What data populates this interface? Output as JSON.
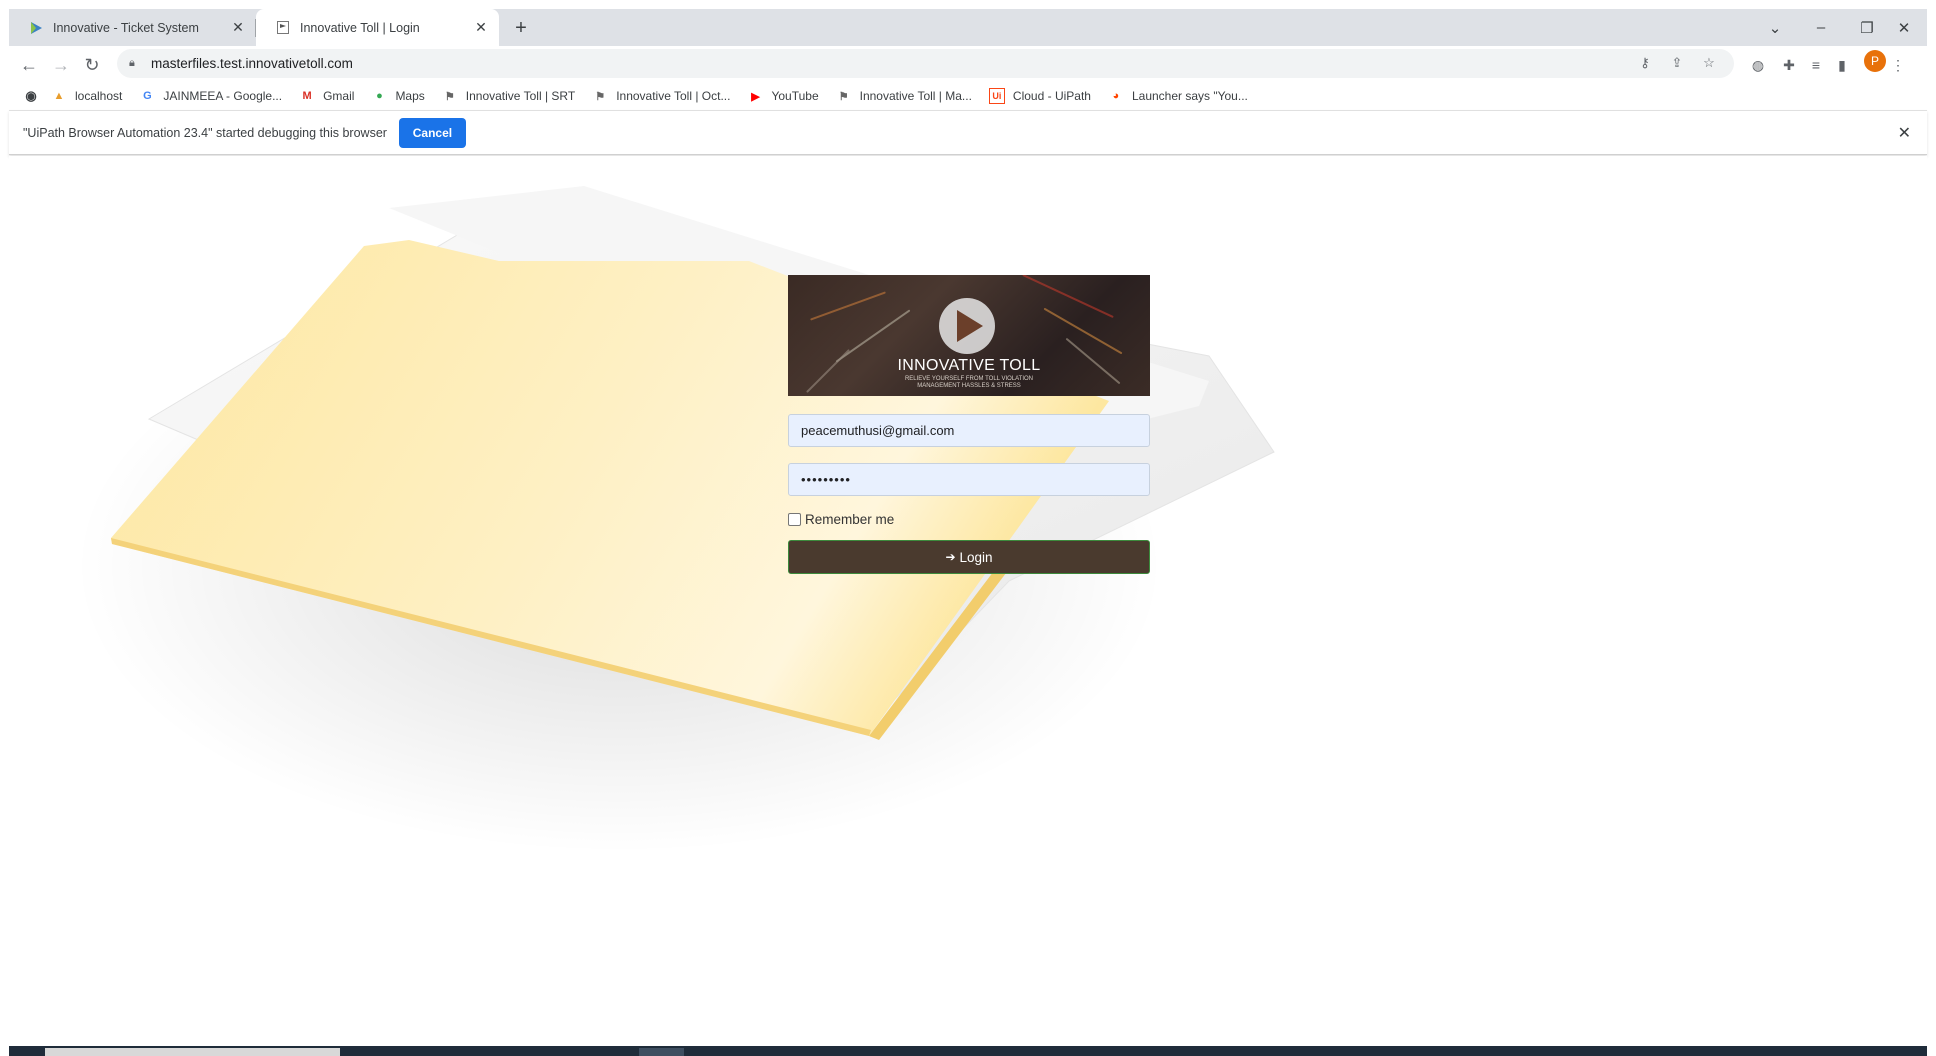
{
  "browser": {
    "tabs": [
      {
        "title": "Innovative - Ticket System",
        "icon": "play-logo-icon"
      },
      {
        "title": "Innovative Toll | Login",
        "icon": "flag-page-icon"
      }
    ],
    "address": {
      "url": "masterfiles.test.innovativetoll.com"
    },
    "bookmarks": [
      {
        "label": "localhost",
        "icon": "phpmyadmin-icon"
      },
      {
        "label": "JAINMEEA - Google...",
        "icon": "google-icon"
      },
      {
        "label": "Gmail",
        "icon": "gmail-icon"
      },
      {
        "label": "Maps",
        "icon": "maps-pin-icon"
      },
      {
        "label": "Innovative Toll | SRT",
        "icon": "flag-page-icon"
      },
      {
        "label": "Innovative Toll | Oct...",
        "icon": "flag-page-icon"
      },
      {
        "label": "YouTube",
        "icon": "youtube-icon"
      },
      {
        "label": "Innovative Toll | Ma...",
        "icon": "flag-page-icon"
      },
      {
        "label": "Cloud - UiPath",
        "icon": "uipath-icon"
      },
      {
        "label": "Launcher says \"You...",
        "icon": "reddit-icon"
      }
    ],
    "infobar": {
      "message": "\"UiPath Browser Automation 23.4\" started debugging this browser",
      "cancel_label": "Cancel"
    },
    "profile_initial": "P"
  },
  "login": {
    "brand": "INNOVATIVE TOLL",
    "tagline_1": "RELIEVE YOURSELF FROM TOLL VIOLATION",
    "tagline_2": "MANAGEMENT HASSLES & STRESS",
    "email_value": "peacemuthusi@gmail.com",
    "password_mask": "•••••••••",
    "remember_label": "Remember me",
    "remember_checked": false,
    "login_label": "Login"
  },
  "colors": {
    "accent": "#1a73e8",
    "login_button": "#4a3a2e",
    "folder": "#fde9a8",
    "autofill": "#e8f0fe"
  }
}
